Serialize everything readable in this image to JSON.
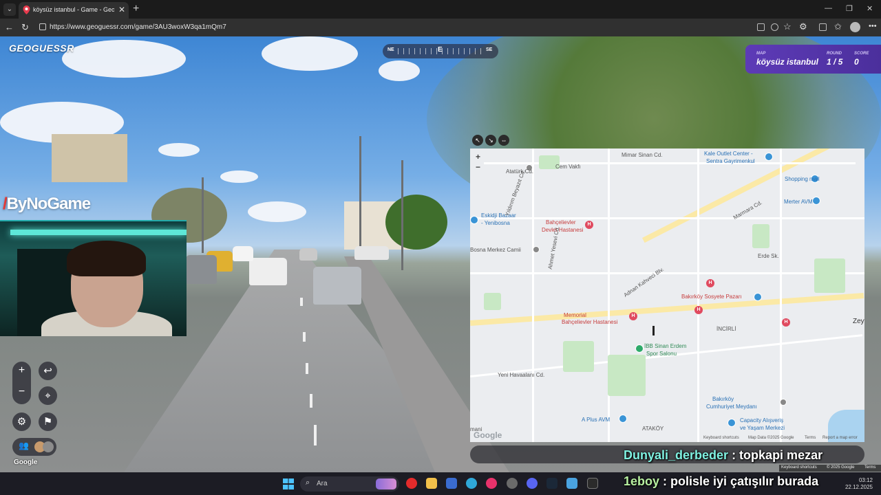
{
  "browser": {
    "tab_title": "köysüz istanbul - Game - GeoGuessr",
    "url": "https://www.geoguessr.com/game/3AU3woxW3qa1mQm7"
  },
  "game": {
    "logo": "GEOGUESSR",
    "compass": {
      "left": "NE",
      "center": "E",
      "right": "SE"
    },
    "status": {
      "map_label": "MAP",
      "map_value": "köysüz istanbul",
      "round_label": "ROUND",
      "round_value": "1 / 5",
      "score_label": "SCORE",
      "score_value": "0"
    },
    "streetview_google": "Google",
    "footer": {
      "shortcuts": "Keyboard shortcuts",
      "copyright": "© 2025 Google",
      "terms": "Terms"
    }
  },
  "stream": {
    "watermark": "ByNoGame",
    "chat": [
      {
        "user": "Dunyali_derbeder",
        "message": " : topkapi mezar"
      },
      {
        "user": "1eboy",
        "message": " : polisle iyi çatışılır burada"
      }
    ]
  },
  "map": {
    "labels": {
      "kale_outlet": "Kale Outlet Center -",
      "sentra": "Sentra Gayrimenkul",
      "cem_vakfi": "Cem Vakfı",
      "ataturk_cd": "Atatürk Cd.",
      "mimar_sinan": "Mimar Sinan Cd.",
      "shopping_mall": "Shopping mall",
      "eskidji": "Eskidji Bazaar",
      "yenibosna": "- Yenibosna",
      "bahcelievler_devlet1": "Bahçelievler",
      "bahcelievler_devlet2": "Devlet Hastanesi",
      "merter_avm": "Merter AVM",
      "bosna_camii": "Bosna Merkez Camii",
      "bakirkoy_sosyete": "Bakırköy Sosyete Pazarı",
      "memorial1": "Memorial",
      "memorial2": "Bahçelievler Hastanesi",
      "incirli": "İNCİRLİ",
      "zeytin": "Zeytin",
      "ibb1": "İBB Sinan Erdem",
      "ibb2": "Spor Salonu",
      "yeni_havaalani": "Yeni Havaalanı Cd.",
      "bakirkoy_meydan1": "Bakırköy",
      "bakirkoy_meydan2": "Cumhuriyet Meydanı",
      "a_plus": "A Plus AVM",
      "atakoy": "ATAKÖY",
      "capacity1": "Capacity Alışveriş",
      "capacity2": "ve Yaşam Merkezi",
      "mani": "mani",
      "ataturk_cd_small": "Atatürk Cd.",
      "yildirim": "Yıldırım Beyazıt Cd.",
      "marmara_cd": "Marmara Cd.",
      "erde_sk": "Erde Sk.",
      "adnan_kahveci": "Adnan Kahveci Blv.",
      "ahmet_yesevi": "Ahmet Yesevi Cd."
    },
    "google": "Google",
    "footer": {
      "shortcuts": "Keyboard shortcuts",
      "data": "Map Data ©2025 Google",
      "terms": "Terms",
      "report": "Report a map error"
    }
  },
  "taskbar": {
    "search_placeholder": "Ara",
    "time": "03:12",
    "date": "22.12.2025"
  }
}
